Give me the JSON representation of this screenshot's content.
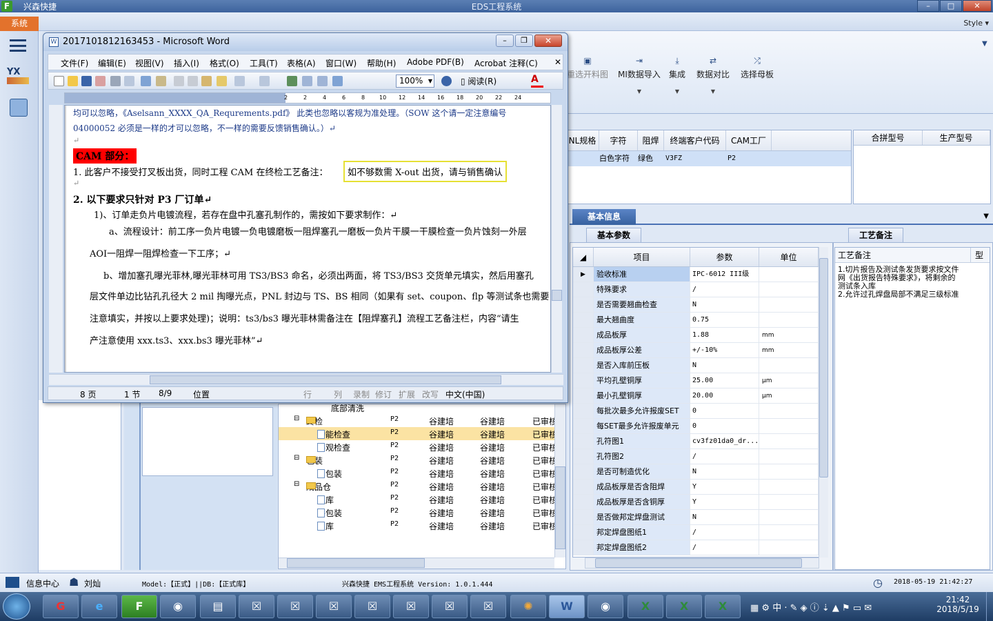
{
  "app": {
    "window_title": "EDS工程系统",
    "app_name": "兴森快捷",
    "system_tab": "系统",
    "style_label": "Style",
    "app_icon_letter": "F"
  },
  "ribbon": {
    "buttons": [
      "重选开料图",
      "MI数据导入",
      "集成",
      "数据对比",
      "选择母板"
    ]
  },
  "top_grid": {
    "headers": [
      "NL规格",
      "字符",
      "阻焊",
      "终端客户代码",
      "CAM工厂"
    ],
    "row": [
      "",
      "白色字符",
      "绿色",
      "V3FZ",
      "P2"
    ],
    "right_headers": [
      "合拼型号",
      "生产型号"
    ]
  },
  "info": {
    "section_tab": "基本信息",
    "param_tab": "基本参数",
    "notes_tab": "工艺备注",
    "param_headers": [
      "项目",
      "参数",
      "单位"
    ],
    "params": [
      {
        "item": "验收标准",
        "value": "IPC-6012 III级",
        "unit": ""
      },
      {
        "item": "特殊要求",
        "value": "/",
        "unit": ""
      },
      {
        "item": "是否需要翘曲检查",
        "value": "N",
        "unit": ""
      },
      {
        "item": "最大翘曲度",
        "value": "0.75",
        "unit": ""
      },
      {
        "item": "成品板厚",
        "value": "1.88",
        "unit": "mm"
      },
      {
        "item": "成品板厚公差",
        "value": "+/-10%",
        "unit": "mm"
      },
      {
        "item": "是否入库前压板",
        "value": "N",
        "unit": ""
      },
      {
        "item": "平均孔壁铜厚",
        "value": "25.00",
        "unit": "μm"
      },
      {
        "item": "最小孔壁铜厚",
        "value": "20.00",
        "unit": "μm"
      },
      {
        "item": "每批次最多允许报废SET",
        "value": "0",
        "unit": ""
      },
      {
        "item": "每SET最多允许报废单元",
        "value": "0",
        "unit": ""
      },
      {
        "item": "孔符图1",
        "value": "cv3fz01da0_dr...",
        "unit": ""
      },
      {
        "item": "孔符图2",
        "value": "/",
        "unit": ""
      },
      {
        "item": "是否可制造优化",
        "value": "N",
        "unit": ""
      },
      {
        "item": "成品板厚是否含阻焊",
        "value": "Y",
        "unit": ""
      },
      {
        "item": "成品板厚是否含铜厚",
        "value": "Y",
        "unit": ""
      },
      {
        "item": "是否做邦定焊盘测试",
        "value": "N",
        "unit": ""
      },
      {
        "item": "邦定焊盘图纸1",
        "value": "/",
        "unit": ""
      },
      {
        "item": "邦定焊盘图纸2",
        "value": "/",
        "unit": ""
      }
    ],
    "notes_header": "工艺备注",
    "notes_col2": "型",
    "notes_text": "1.切片报告及测试条发货要求按文件网《出货报告特殊要求》，将剩余的测试条入库\n2.允许过孔焊盘局部不满足三级标准"
  },
  "tree": {
    "partial_top": "底部清洗",
    "rows": [
      {
        "label": "终检",
        "type": "folder",
        "indent": 1,
        "c1": "P2",
        "c2": "谷建培",
        "c3": "谷建培",
        "c4": "已审核"
      },
      {
        "label": "功能检查",
        "type": "doc",
        "indent": 2,
        "c1": "P2",
        "c2": "谷建培",
        "c3": "谷建培",
        "c4": "已审核",
        "selected": true
      },
      {
        "label": "外观检查",
        "type": "doc",
        "indent": 2,
        "c1": "P2",
        "c2": "谷建培",
        "c3": "谷建培",
        "c4": "已审核"
      },
      {
        "label": "包装",
        "type": "folder",
        "indent": 1,
        "c1": "P2",
        "c2": "谷建培",
        "c3": "谷建培",
        "c4": "已审核"
      },
      {
        "label": "内包装",
        "type": "doc",
        "indent": 2,
        "c1": "P2",
        "c2": "谷建培",
        "c3": "谷建培",
        "c4": "已审核"
      },
      {
        "label": "成品仓",
        "type": "folder",
        "indent": 1,
        "c1": "P2",
        "c2": "谷建培",
        "c3": "谷建培",
        "c4": "已审核"
      },
      {
        "label": "入库",
        "type": "doc",
        "indent": 2,
        "c1": "P2",
        "c2": "谷建培",
        "c3": "谷建培",
        "c4": "已审核"
      },
      {
        "label": "外包装",
        "type": "doc",
        "indent": 2,
        "c1": "P2",
        "c2": "谷建培",
        "c3": "谷建培",
        "c4": "已审核"
      },
      {
        "label": "出库",
        "type": "doc",
        "indent": 2,
        "c1": "P2",
        "c2": "谷建培",
        "c3": "谷建培",
        "c4": "已审核"
      }
    ]
  },
  "statusbar": {
    "info_center": "信息中心",
    "user": "刘灿",
    "model": "Model:【正式】||DB:【正式库】",
    "version": "兴森快捷 EMS工程系统 Version: 1.0.1.444",
    "datetime": "2018-05-19 21:42:27"
  },
  "word": {
    "title": "2017101812163453 - Microsoft Word",
    "menus": [
      "文件(F)",
      "编辑(E)",
      "视图(V)",
      "插入(I)",
      "格式(O)",
      "工具(T)",
      "表格(A)",
      "窗口(W)",
      "帮助(H)",
      "Adobe PDF(B)",
      "Acrobat 注释(C)"
    ],
    "zoom": "100%",
    "read_label": "阅读(R)",
    "ruler_numbers": [
      "2",
      "2",
      "4",
      "6",
      "8",
      "10",
      "12",
      "14",
      "16",
      "18",
      "20",
      "22",
      "24"
    ],
    "doc_lines": [
      "均可以忽略，《Aselsann_XXXX_QA_Requrements.pdf》 此类也忽略以客规为准处理。（SOW 这个请一定注意编号",
      "04000052 必须是一样的才可以忽略，不一样的需要反馈销售确认。）↵",
      "↵",
      "CAM 部分：",
      "1.    此客户不接受打叉板出货，同时工程 CAM 在终检工艺备注：",
      "如不够数需 X-out 出货，请与销售确认",
      "↵",
      "2.    以下要求只针对 P3 厂订单↵",
      "1)、订单走负片电镀流程，若存在盘中孔塞孔制作的，需按如下要求制作：↵",
      "a、流程设计：前工序一负片电镀一负电镀磨板一阻焊塞孔一磨板一负片干膜一干膜检查一负片蚀刻一外层",
      "AOI一阻焊一阻焊检查一下工序；↵",
      "b、增加塞孔曝光菲林,曝光菲林可用 TS3/BS3 命名，必须出两面，将 TS3/BS3 交货单元填实，然后用塞孔",
      "层文件单边比钻孔孔径大 2 mil 掏曝光点，PNL 封边与 TS、BS 相同（如果有 set、coupon、flp 等测试条也需要",
      "注意填实，并按以上要求处理)；说明：ts3/bs3 曝光菲林需备注在【阻焊塞孔】流程工艺备注栏，内容“请生",
      "产注意使用 xxx.ts3、xxx.bs3 曝光菲林”↵"
    ],
    "status": {
      "page": "8 页",
      "section": "1 节",
      "pages": "8/9",
      "position": "位置",
      "line": "行",
      "col": "列",
      "rec": "录制",
      "trk": "修订",
      "ext": "扩展",
      "ovr": "改写",
      "lang": "中文(中国)"
    }
  },
  "taskbar": {
    "clock_time": "21:42",
    "clock_date": "2018/5/19",
    "ime": "中"
  },
  "colors": {
    "accent": "#3d639d",
    "system_tab": "#e3722c",
    "highlight_box": "#e6e034",
    "cam_label_bg": "#ff0000"
  }
}
